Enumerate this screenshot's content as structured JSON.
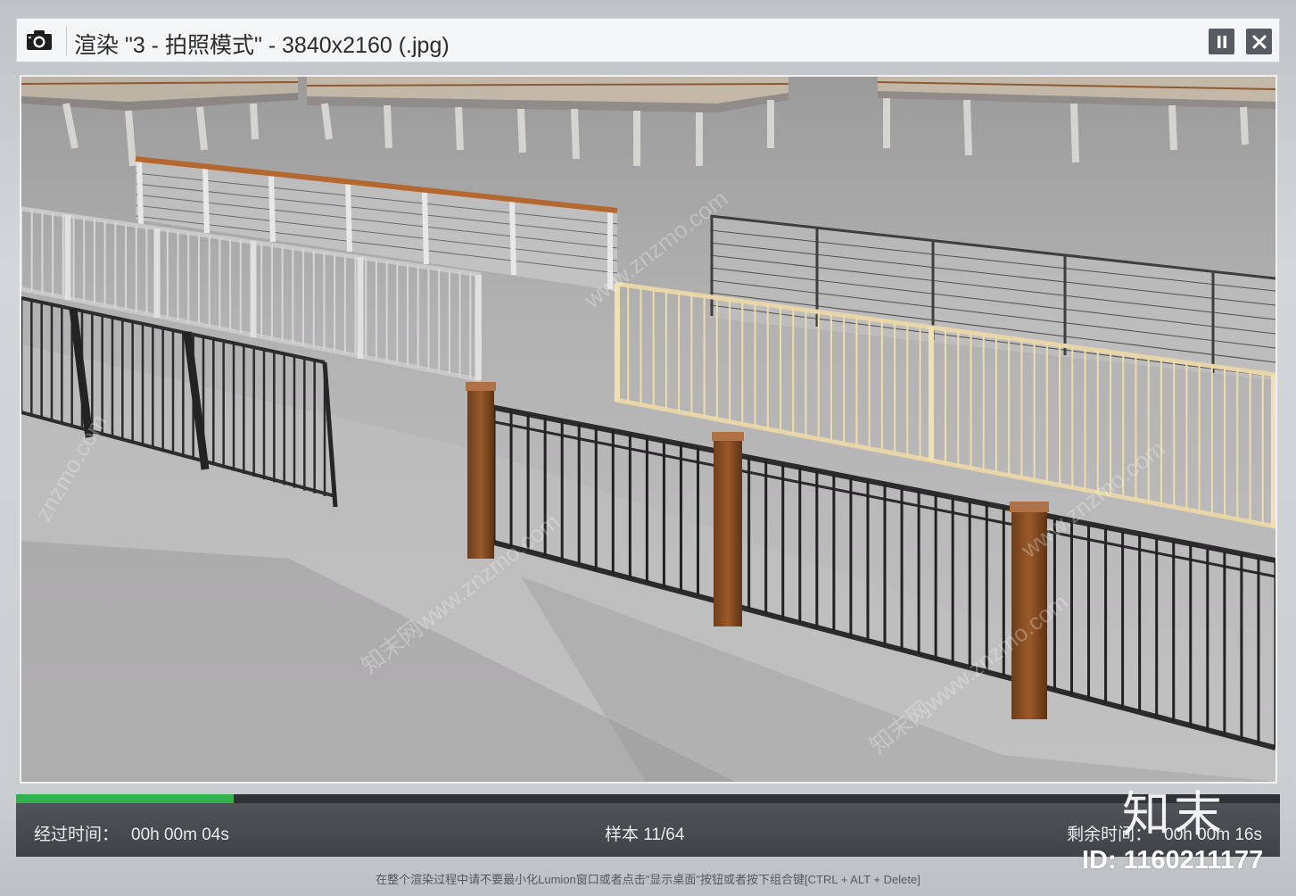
{
  "window": {
    "title": "渲染 \"3 - 拍照模式\" - 3840x2160 (.jpg)",
    "icon": "camera-icon",
    "buttons": {
      "pause_icon": "pause-icon",
      "close_icon": "close-icon"
    }
  },
  "render": {
    "progress_fraction": 0.172,
    "progress_color": "#33b14a"
  },
  "status": {
    "elapsed_label": "经过时间：",
    "elapsed_value": "00h 00m 04s",
    "sample_text": "样本 11/64",
    "remaining_label": "剩余时间：",
    "remaining_value": "00h 00m 16s"
  },
  "hint": "在整个渲染过程中请不要最小化Lumion窗口或者点击\"显示桌面\"按钮或者按下组合键[CTRL + ALT + Delete]",
  "watermark": {
    "brand": "知末",
    "id": "ID: 1160211177"
  }
}
